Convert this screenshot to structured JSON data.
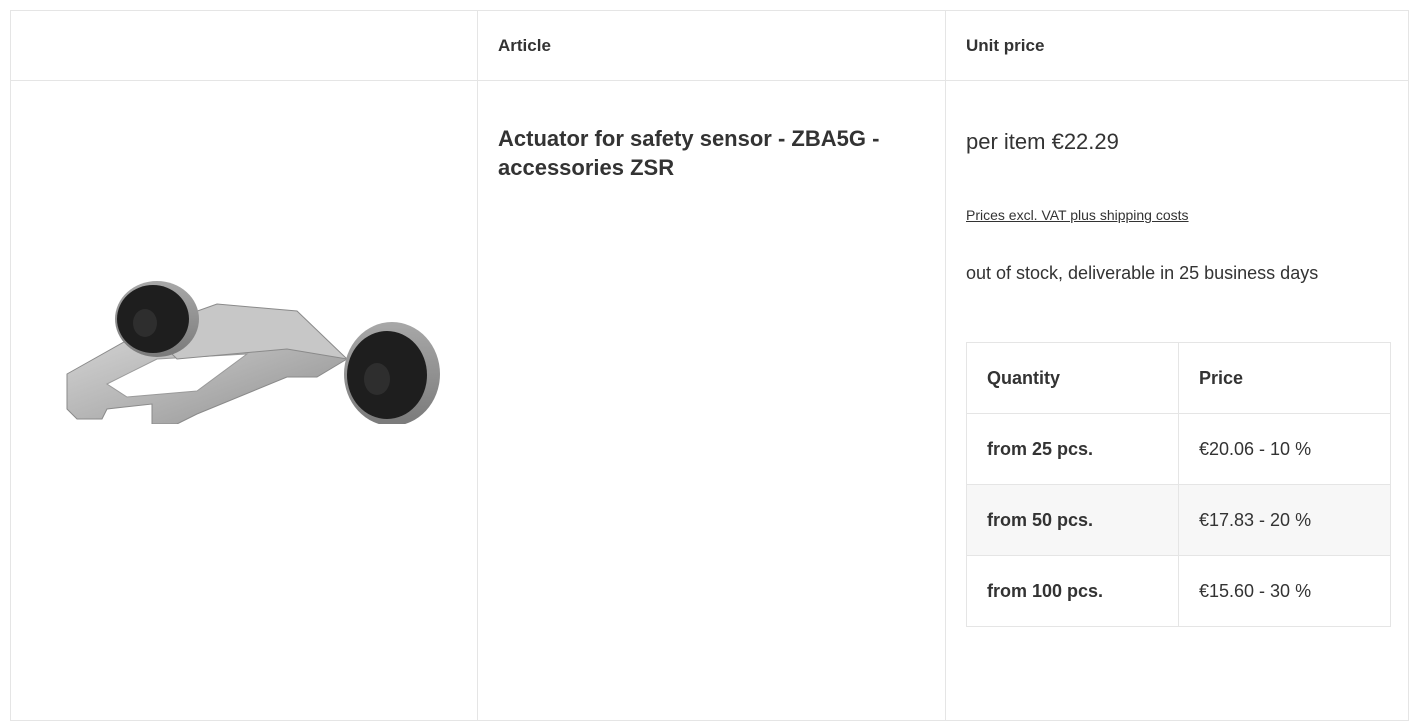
{
  "header": {
    "col_image": "",
    "col_article": "Article",
    "col_unit_price": "Unit price"
  },
  "product": {
    "title": "Actuator for safety sensor - ZBA5G - accessories ZSR",
    "unit_price": "per item €22.29",
    "vat_note": "Prices excl. VAT plus shipping costs",
    "stock": "out of stock, deliverable in 25 business days"
  },
  "tiers": {
    "header_quantity": "Quantity",
    "header_price": "Price",
    "rows": [
      {
        "qty": "from 25 pcs.",
        "price": "€20.06 - 10 %"
      },
      {
        "qty": "from 50 pcs.",
        "price": "€17.83 - 20 %"
      },
      {
        "qty": "from 100 pcs.",
        "price": "€15.60 - 30 %"
      }
    ]
  },
  "colors": {
    "text": "#333333",
    "border": "#e5e5e5",
    "alt_row": "#f7f7f7"
  }
}
